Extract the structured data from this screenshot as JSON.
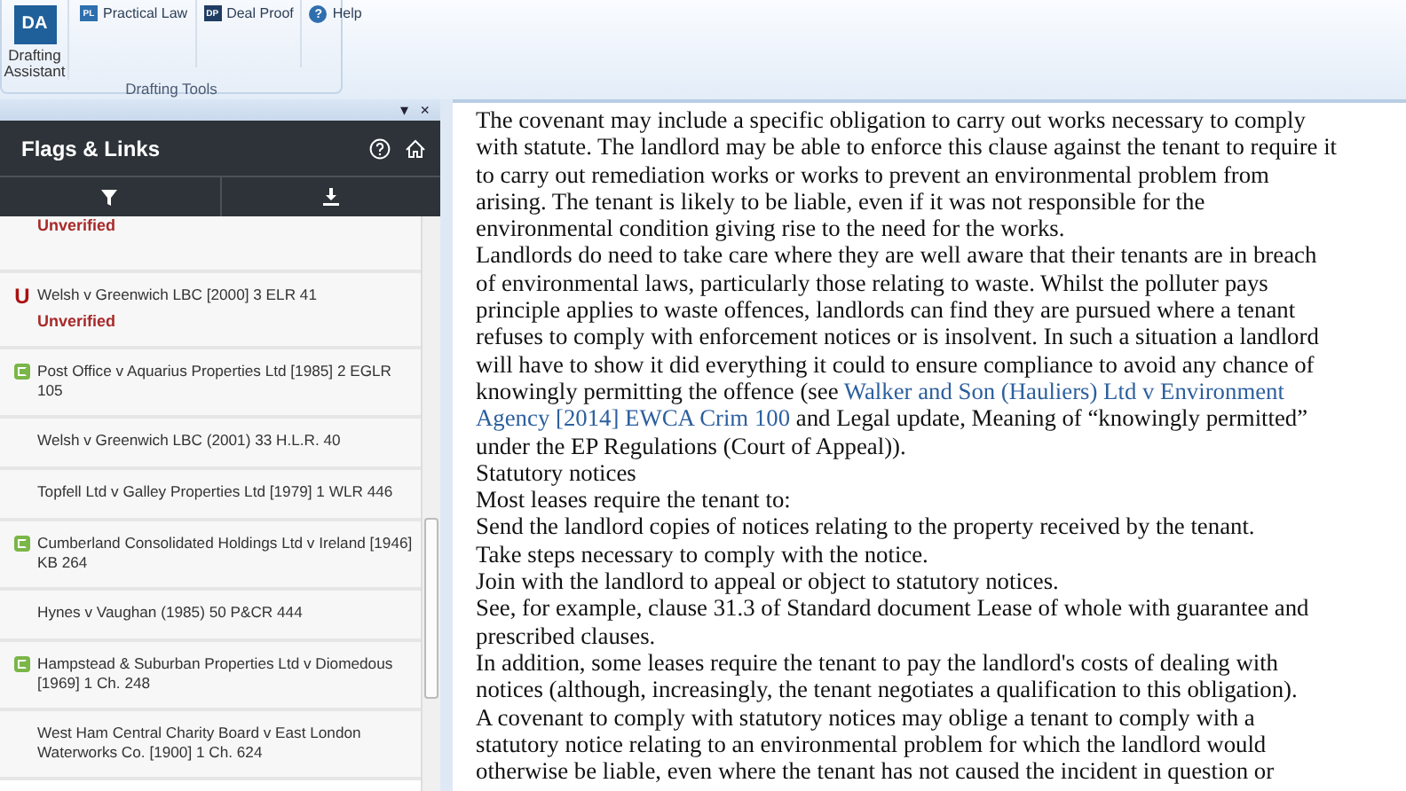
{
  "ribbon": {
    "buttons": [
      {
        "kind": "large",
        "icon_text": "DA",
        "label": "Drafting Assistant"
      },
      {
        "kind": "small",
        "icon_text": "PL",
        "label": "Practical Law"
      },
      {
        "kind": "small",
        "icon_text": "DP",
        "label": "Deal Proof"
      },
      {
        "kind": "help",
        "icon_text": "?",
        "label": "Help"
      }
    ],
    "group_label": "Drafting Tools"
  },
  "pane": {
    "controls": [
      "▾",
      "×"
    ],
    "title": "Flags & Links",
    "items": [
      {
        "kind": "plain",
        "status": "Unverified"
      },
      {
        "kind": "unverified",
        "badge": "U",
        "title": "Welsh v Greenwich LBC [2000] 3 ELR 41",
        "status": "Unverified"
      },
      {
        "kind": "case",
        "title": "Post Office v Aquarius Properties Ltd [1985] 2 EGLR 105"
      },
      {
        "kind": "plain",
        "title": "Welsh v Greenwich LBC (2001) 33 H.L.R. 40"
      },
      {
        "kind": "plain",
        "title": "Topfell Ltd v Galley Properties Ltd [1979] 1 WLR 446"
      },
      {
        "kind": "case",
        "title": "Cumberland Consolidated Holdings Ltd v Ireland [1946] KB 264"
      },
      {
        "kind": "plain",
        "title": "Hynes v Vaughan (1985) 50 P&CR 444"
      },
      {
        "kind": "case",
        "title": "Hampstead & Suburban Properties Ltd v Diomedous [1969] 1 Ch. 248"
      },
      {
        "kind": "plain",
        "title": "West Ham Central Charity Board v East London Waterworks Co. [1900] 1 Ch. 624"
      }
    ]
  },
  "document": {
    "paragraphs": [
      [
        {
          "kind": "text",
          "text": "The covenant may include a specific obligation to carry out works necessary to comply with statute. The landlord may be able to enforce this clause against the tenant to require it to carry out remediation works or works to prevent an environmental problem from arising. The tenant is likely to be liable, even if it was not responsible for the environmental condition giving rise to the need for the works."
        }
      ],
      [
        {
          "kind": "text",
          "text": "Landlords do need to take care where they are well aware that their tenants are in breach of environmental laws, particularly those relating to waste.  Whilst the polluter pays principle applies to waste offences, landlords can find they are pursued where a tenant refuses to comply with enforcement notices or is insolvent. In such a situation a landlord will have to show it did everything it could to ensure compliance to avoid any chance of knowingly permitting the offence (see"
        },
        {
          "kind": "link",
          "text": "Walker and Son (Hauliers) Ltd v Environment"
        },
        {
          "kind": "link",
          "text": "Agency [2014] EWCA Crim 100"
        },
        {
          "kind": "text",
          "text": "and Legal  update, Meaning of “knowingly permitted” under the EP Regulations (Court of Appeal))."
        }
      ],
      [
        {
          "kind": "text",
          "text": "Statutory notices"
        }
      ],
      [
        {
          "kind": "text",
          "text": "Most leases require the tenant to:"
        }
      ],
      [
        {
          "kind": "text",
          "text": "Send the landlord copies of notices relating to the property received by the tenant."
        }
      ],
      [
        {
          "kind": "text",
          "text": "Take steps necessary to comply with the notice."
        }
      ],
      [
        {
          "kind": "text",
          "text": "Join with the landlord to appeal or object to statutory notices."
        }
      ],
      [
        {
          "kind": "text",
          "text": "See, for example, clause 31.3 of Standard document Lease  of whole with guarantee and prescribed clauses."
        }
      ],
      [
        {
          "kind": "text",
          "text": "In addition, some leases require the tenant to pay the landlord's costs of dealing with notices (although, increasingly, the tenant negotiates a qualification to this obligation)."
        }
      ],
      [
        {
          "kind": "text",
          "text": "A covenant to comply with statutory notices may oblige a tenant to comply with a statutory notice relating to an environmental problem for which the landlord would otherwise be liable, even where the tenant has not caused the incident in question or"
        }
      ]
    ]
  }
}
